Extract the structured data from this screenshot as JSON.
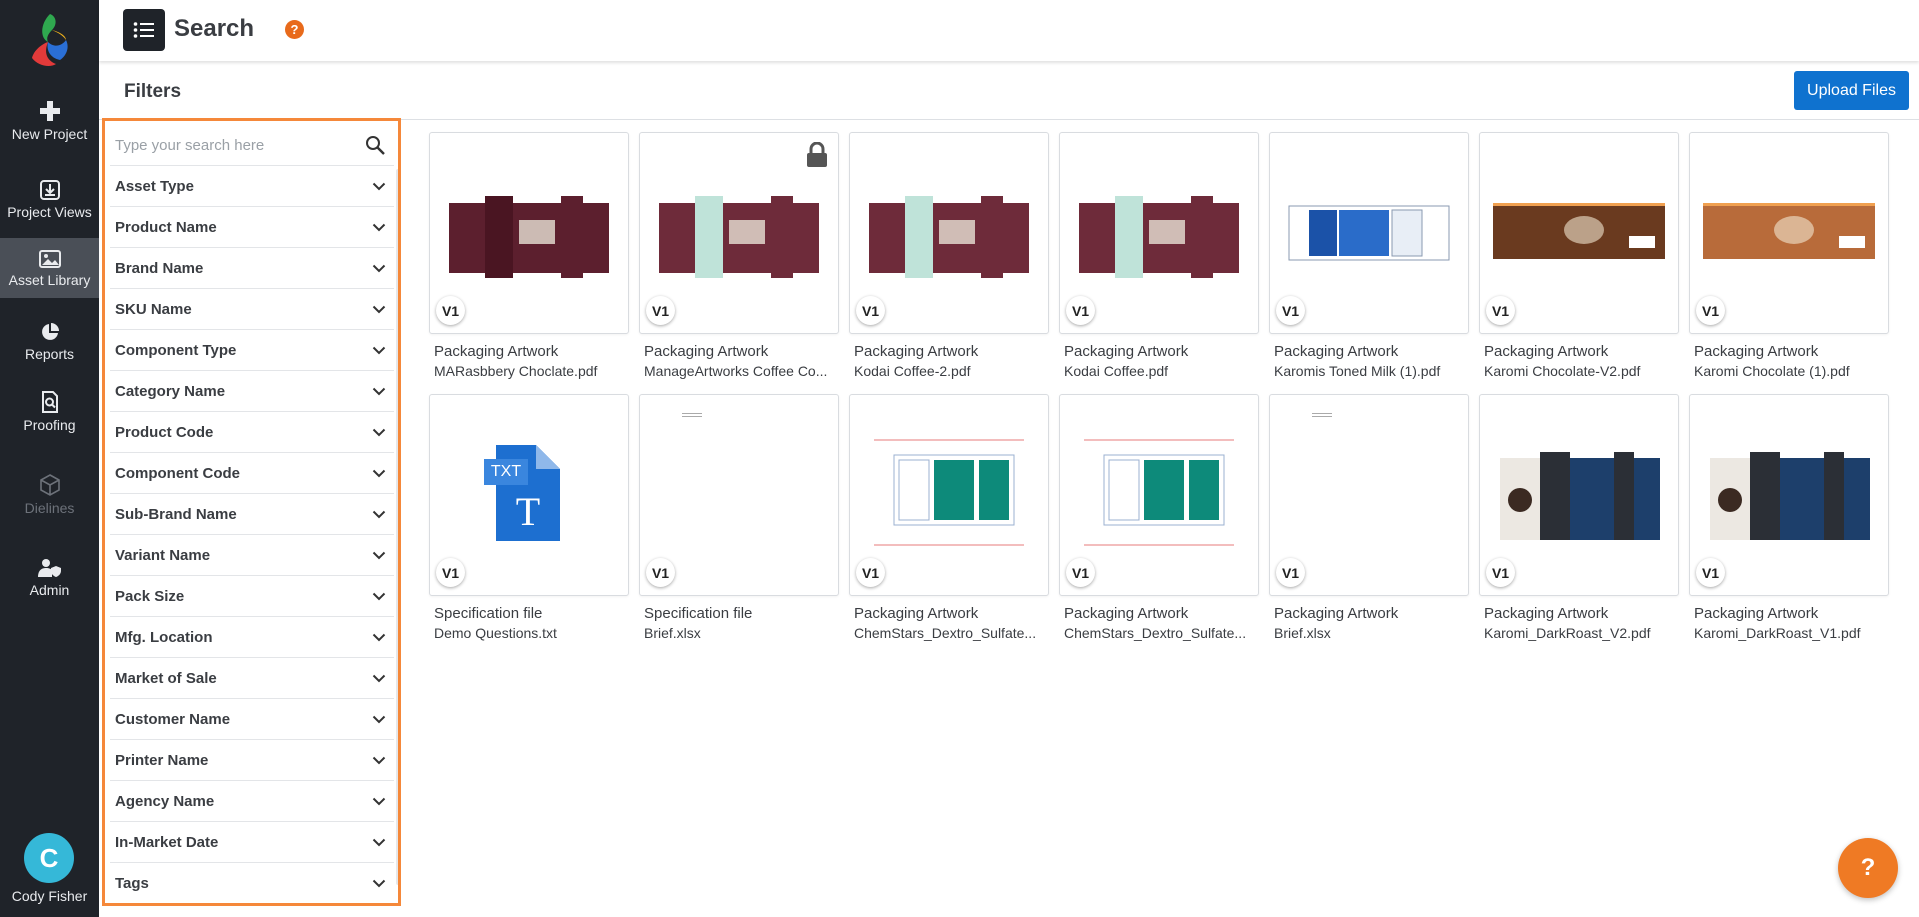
{
  "nav": {
    "items": [
      {
        "label": "New Project",
        "icon": "plus-icon"
      },
      {
        "label": "Project Views",
        "icon": "download-box-icon"
      },
      {
        "label": "Asset Library",
        "icon": "image-icon"
      },
      {
        "label": "Reports",
        "icon": "pie-chart-icon"
      },
      {
        "label": "Proofing",
        "icon": "proof-search-icon"
      },
      {
        "label": "Dielines",
        "icon": "cube-icon"
      },
      {
        "label": "Admin",
        "icon": "user-shield-icon"
      }
    ],
    "user": {
      "initial": "C",
      "name": "Cody Fisher"
    }
  },
  "header": {
    "title": "Search",
    "help": "?"
  },
  "filters": {
    "title": "Filters",
    "upload_label": "Upload Files",
    "search_placeholder": "Type your search here",
    "items": [
      "Asset Type",
      "Product Name",
      "Brand Name",
      "SKU Name",
      "Component Type",
      "Category Name",
      "Product Code",
      "Component Code",
      "Sub-Brand Name",
      "Variant Name",
      "Pack Size",
      "Mfg. Location",
      "Market of Sale",
      "Customer Name",
      "Printer Name",
      "Agency Name",
      "In-Market Date",
      "Tags"
    ]
  },
  "assets": [
    {
      "type": "Packaging Artwork",
      "file": "MARasbbery Choclate.pdf",
      "version": "V1",
      "locked": false
    },
    {
      "type": "Packaging Artwork",
      "file": "ManageArtworks Coffee Co...",
      "version": "V1",
      "locked": true
    },
    {
      "type": "Packaging Artwork",
      "file": "Kodai Coffee-2.pdf",
      "version": "V1",
      "locked": false
    },
    {
      "type": "Packaging Artwork",
      "file": "Kodai Coffee.pdf",
      "version": "V1",
      "locked": false
    },
    {
      "type": "Packaging Artwork",
      "file": "Karomis Toned Milk (1).pdf",
      "version": "V1",
      "locked": false
    },
    {
      "type": "Packaging Artwork",
      "file": "Karomi Chocolate-V2.pdf",
      "version": "V1",
      "locked": false
    },
    {
      "type": "Packaging Artwork",
      "file": "Karomi Chocolate (1).pdf",
      "version": "V1",
      "locked": false
    },
    {
      "type": "Specification file",
      "file": "Demo Questions.txt",
      "version": "V1",
      "locked": false,
      "badge": "TXT",
      "glyph": "T"
    },
    {
      "type": "Specification file",
      "file": "Brief.xlsx",
      "version": "V1",
      "locked": false
    },
    {
      "type": "Packaging Artwork",
      "file": "ChemStars_Dextro_Sulfate...",
      "version": "V1",
      "locked": false
    },
    {
      "type": "Packaging Artwork",
      "file": "ChemStars_Dextro_Sulfate...",
      "version": "V1",
      "locked": false
    },
    {
      "type": "Packaging Artwork",
      "file": "Brief.xlsx",
      "version": "V1",
      "locked": false
    },
    {
      "type": "Packaging Artwork",
      "file": "Karomi_DarkRoast_V2.pdf",
      "version": "V1",
      "locked": false
    },
    {
      "type": "Packaging Artwork",
      "file": "Karomi_DarkRoast_V1.pdf",
      "version": "V1",
      "locked": false
    }
  ],
  "fab": {
    "label": "?"
  },
  "colors": {
    "accent": "#0f72cf",
    "nav_bg": "#1f2329",
    "filter_border": "#f5883a",
    "help": "#e86a1b"
  }
}
